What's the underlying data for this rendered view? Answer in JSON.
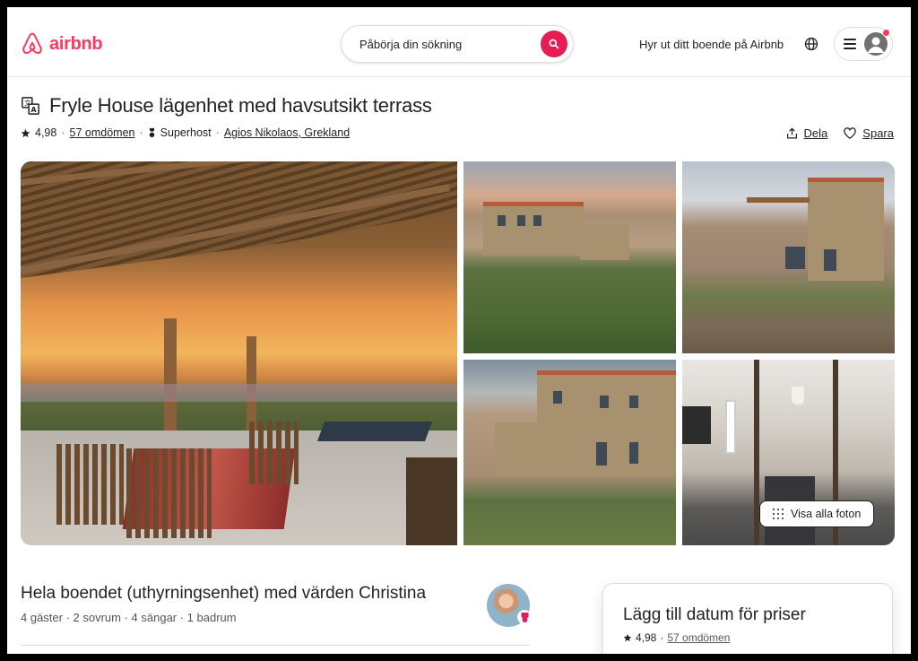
{
  "header": {
    "logo_text": "airbnb",
    "search_placeholder": "Påbörja din sökning",
    "host_link": "Hyr ut ditt boende på Airbnb"
  },
  "listing": {
    "title": "Fryle House lägenhet med havsutsikt terrass",
    "rating": "4,98",
    "reviews": "57 omdömen",
    "superhost": "Superhost",
    "location": "Agios Nikolaos, Grekland",
    "share_label": "Dela",
    "save_label": "Spara",
    "show_all_photos": "Visa alla foton"
  },
  "host_section": {
    "title": "Hela boendet (uthyrningsenhet) med värden Christina",
    "details": "4 gäster · 2 sovrum · 4 sängar · 1 badrum"
  },
  "price_card": {
    "title": "Lägg till datum för priser",
    "rating": "4,98",
    "reviews": "57 omdömen"
  },
  "colors": {
    "brand": "#ff385c",
    "search_button": "#e51d53",
    "text": "#222222"
  },
  "icons": [
    "airbnb-logo-icon",
    "search-icon",
    "globe-icon",
    "menu-icon",
    "user-avatar-icon",
    "translate-icon",
    "star-icon",
    "superhost-icon",
    "share-icon",
    "heart-icon",
    "grid-dots-icon",
    "superhost-badge-icon"
  ]
}
